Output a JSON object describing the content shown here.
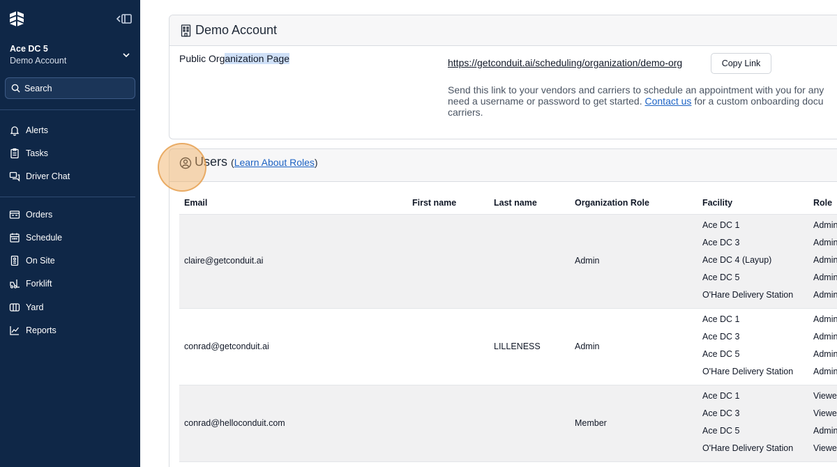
{
  "sidebar": {
    "org_name": "Ace DC 5",
    "org_sub": "Demo Account",
    "search_label": "Search",
    "nav_group1": [
      {
        "label": "Alerts",
        "icon": "bell-icon"
      },
      {
        "label": "Tasks",
        "icon": "clipboard-icon"
      },
      {
        "label": "Driver Chat",
        "icon": "chat-icon"
      }
    ],
    "nav_group2": [
      {
        "label": "Orders",
        "icon": "orders-icon"
      },
      {
        "label": "Schedule",
        "icon": "calendar-icon"
      },
      {
        "label": "On Site",
        "icon": "building-icon"
      },
      {
        "label": "Forklift",
        "icon": "forklift-icon"
      },
      {
        "label": "Yard",
        "icon": "map-icon"
      },
      {
        "label": "Reports",
        "icon": "chart-line-icon"
      }
    ]
  },
  "account": {
    "title": "Demo Account",
    "public_label_pre": "Public Org",
    "public_label_hl": "anization Page",
    "url": "https://getconduit.ai/scheduling/organization/demo-org",
    "copy_label": "Copy Link",
    "help_line1": "Send this link to your vendors and carriers to schedule an appointment with you for any",
    "help_line2_pre": "need a username or password to get started. ",
    "help_link": "Contact us",
    "help_line2_post": " for a custom onboarding docu",
    "help_line3": "carriers."
  },
  "users": {
    "title": "Users",
    "paren_open": "(",
    "roles_link": "Learn About Roles",
    "paren_close": ")",
    "columns": [
      "Email",
      "First name",
      "Last name",
      "Organization Role",
      "Facility",
      "Role"
    ],
    "rows": [
      {
        "email": "claire@getconduit.ai",
        "first": "",
        "last": "",
        "org_role": "Admin",
        "facilities": [
          {
            "name": "Ace DC 1",
            "role": "Admin"
          },
          {
            "name": "Ace DC 3",
            "role": "Admin"
          },
          {
            "name": "Ace DC 4 (Layup)",
            "role": "Admin"
          },
          {
            "name": "Ace DC 5",
            "role": "Admin"
          },
          {
            "name": "O'Hare Delivery Station",
            "role": "Admin"
          }
        ]
      },
      {
        "email": "conrad@getconduit.ai",
        "first": "",
        "last": "LILLENESS",
        "org_role": "Admin",
        "facilities": [
          {
            "name": "Ace DC 1",
            "role": "Admin"
          },
          {
            "name": "Ace DC 3",
            "role": "Admin"
          },
          {
            "name": "Ace DC 5",
            "role": "Admin"
          },
          {
            "name": "O'Hare Delivery Station",
            "role": "Admin"
          }
        ]
      },
      {
        "email": "conrad@helloconduit.com",
        "first": "",
        "last": "",
        "org_role": "Member",
        "facilities": [
          {
            "name": "Ace DC 1",
            "role": "Viewer"
          },
          {
            "name": "Ace DC 3",
            "role": "Viewer"
          },
          {
            "name": "Ace DC 5",
            "role": "Admin"
          },
          {
            "name": "O'Hare Delivery Station",
            "role": "Viewer"
          }
        ]
      }
    ]
  },
  "colors": {
    "sidebar_bg": "#0f2747",
    "link": "#1d63c4",
    "row_stripe": "#f1f1f2",
    "highlight": "#f0aa5a"
  }
}
